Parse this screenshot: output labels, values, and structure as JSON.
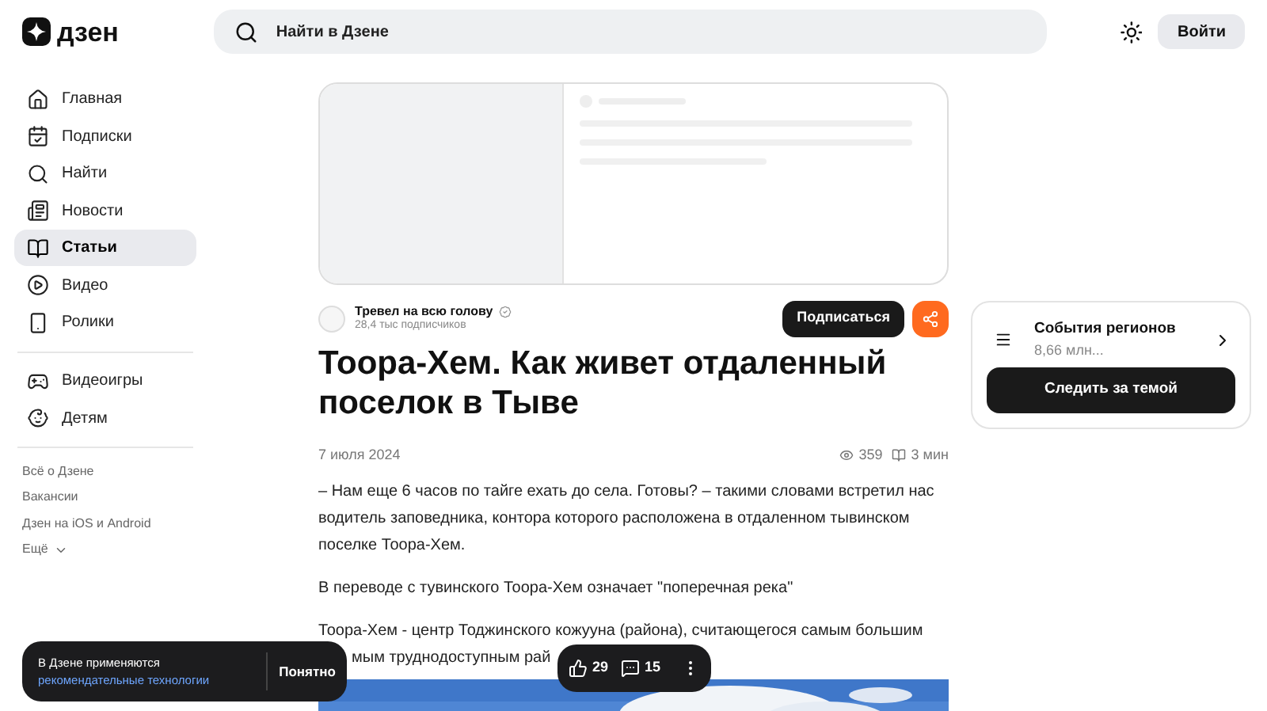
{
  "header": {
    "logo": "дзен",
    "search": {
      "placeholder": "Найти в Дзене"
    },
    "login": "Войти"
  },
  "sidebar": {
    "items": [
      {
        "label": "Главная",
        "selected": false
      },
      {
        "label": "Подписки",
        "selected": false
      },
      {
        "label": "Найти",
        "selected": false
      },
      {
        "label": "Новости",
        "selected": false
      },
      {
        "label": "Статьи",
        "selected": true
      },
      {
        "label": "Видео",
        "selected": false
      },
      {
        "label": "Ролики",
        "selected": false
      }
    ],
    "extra_items": [
      {
        "label": "Видеоигры",
        "selected": false
      },
      {
        "label": "Детям",
        "selected": false
      }
    ],
    "links": [
      "Всё о Дзене",
      "Вакансии",
      "Дзен на iOS и Android"
    ],
    "more": "Ещё"
  },
  "article": {
    "channel": {
      "name": "Тревел на всю голову",
      "subscribers": "28,4 тыс подписчиков",
      "verified": true
    },
    "subscribe": "Подписаться",
    "title": "Тоора-Хем. Как живет отдаленный поселок в Тыве",
    "date": "7 июля 2024",
    "views": "359",
    "read_time": "3 мин",
    "paragraphs": [
      "– Нам еще 6 часов по тайге ехать до села. Готовы? – такими словами встретил нас водитель заповедника, контора которого расположена в отдаленном тывинском поселке Тоора-Хем.",
      "В переводе с тувинского Тоора-Хем означает \"поперечная река\"",
      "Тоора-Хем - центр Тоджинского кожууна (района), считающегося самым большим"
    ],
    "partial_line": "мым труднодоступным рай"
  },
  "topic_card": {
    "title": "События регионов",
    "subtitle": "8,66 млн...",
    "follow": "Следить за темой"
  },
  "cookie_banner": {
    "text": "В Дзене применяются",
    "link": "рекомендательные технологии",
    "ok": "Понятно"
  },
  "actions": {
    "likes": "29",
    "comments": "15"
  }
}
